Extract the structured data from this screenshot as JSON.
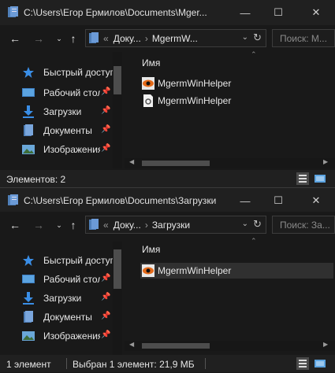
{
  "window1": {
    "title": "C:\\Users\\Егор Ермилов\\Documents\\Mger...",
    "breadcrumb": [
      "Доку...",
      "MgermW..."
    ],
    "search_placeholder": "Поиск: M...",
    "sidebar": [
      {
        "label": "Быстрый доступ",
        "icon": "star-icon",
        "pinned": false
      },
      {
        "label": "Рабочий стол",
        "icon": "desktop-icon",
        "pinned": true
      },
      {
        "label": "Загрузки",
        "icon": "downloads-icon",
        "pinned": true
      },
      {
        "label": "Документы",
        "icon": "documents-icon",
        "pinned": true
      },
      {
        "label": "Изображения",
        "icon": "pictures-icon",
        "pinned": true
      }
    ],
    "column_name": "Имя",
    "files": [
      {
        "name": "MgermWinHelper",
        "icon": "app-eye-icon",
        "selected": false
      },
      {
        "name": "MgermWinHelper",
        "icon": "config-file-icon",
        "selected": false
      }
    ],
    "status": {
      "count": "Элементов: 2"
    }
  },
  "window2": {
    "title": "C:\\Users\\Егор Ермилов\\Documents\\Загрузки",
    "breadcrumb": [
      "Доку...",
      "Загрузки"
    ],
    "search_placeholder": "Поиск: За...",
    "sidebar": [
      {
        "label": "Быстрый доступ",
        "icon": "star-icon",
        "pinned": false
      },
      {
        "label": "Рабочий стол",
        "icon": "desktop-icon",
        "pinned": true
      },
      {
        "label": "Загрузки",
        "icon": "downloads-icon",
        "pinned": true
      },
      {
        "label": "Документы",
        "icon": "documents-icon",
        "pinned": true
      },
      {
        "label": "Изображения",
        "icon": "pictures-icon",
        "pinned": true
      }
    ],
    "column_name": "Имя",
    "files": [
      {
        "name": "MgermWinHelper",
        "icon": "app-eye-icon",
        "selected": true
      }
    ],
    "status": {
      "count": "1 элемент",
      "selection": "Выбран 1 элемент: 21,9 МБ"
    }
  },
  "colors": {
    "background": "#191919",
    "titlebar": "#202020",
    "accent_blue": "#3a8ee6",
    "folder_blue": "#5b8fc9",
    "selection": "#303030"
  }
}
